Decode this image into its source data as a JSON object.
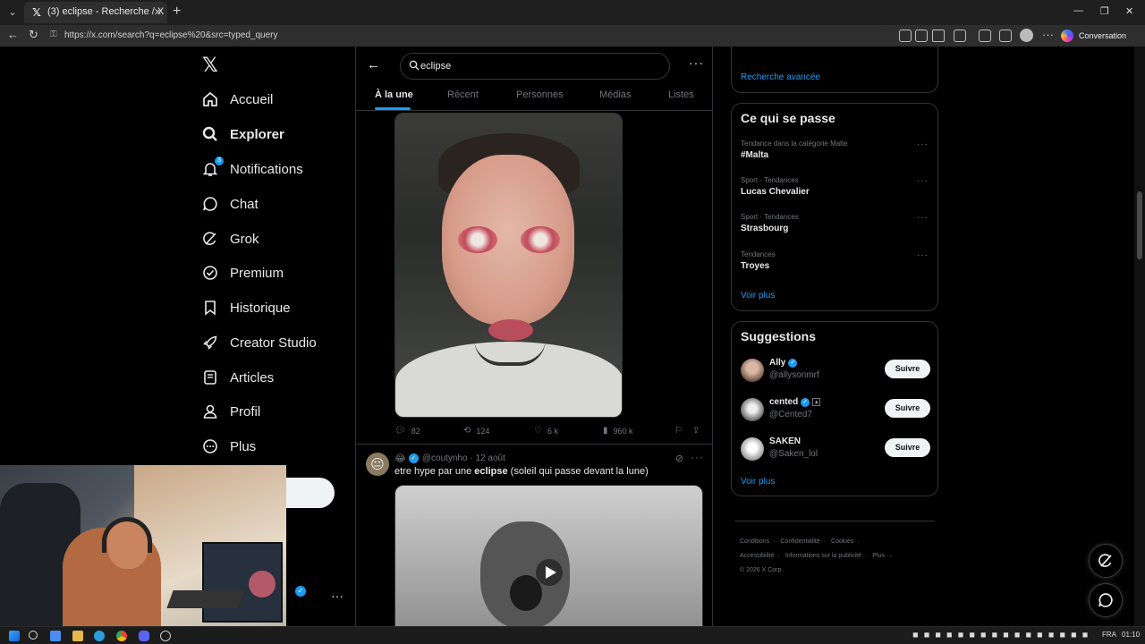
{
  "browser": {
    "tab_title": "(3) eclipse - Recherche / X",
    "url": "https://x.com/search?q=eclipse%20&src=typed_query",
    "conversation_label": "Conversation"
  },
  "nav": {
    "items": [
      {
        "label": "Accueil",
        "icon": "home-icon"
      },
      {
        "label": "Explorer",
        "icon": "search-icon",
        "active": true
      },
      {
        "label": "Notifications",
        "icon": "bell-icon",
        "badge": "3"
      },
      {
        "label": "Chat",
        "icon": "chat-icon"
      },
      {
        "label": "Grok",
        "icon": "grok-icon"
      },
      {
        "label": "Premium",
        "icon": "premium-icon"
      },
      {
        "label": "Historique",
        "icon": "bookmark-icon"
      },
      {
        "label": "Creator Studio",
        "icon": "rocket-icon"
      },
      {
        "label": "Articles",
        "icon": "articles-icon"
      },
      {
        "label": "Profil",
        "icon": "profile-icon"
      },
      {
        "label": "Plus",
        "icon": "more-circle-icon"
      }
    ]
  },
  "search": {
    "query": "eclipse",
    "tabs": [
      "À la une",
      "Récent",
      "Personnes",
      "Médias",
      "Listes"
    ],
    "active_tab": "À la une"
  },
  "tweet1": {
    "stats": {
      "replies": "82",
      "reposts": "124",
      "likes": "6 k",
      "views": "960 k"
    }
  },
  "tweet2": {
    "emoji": "😂",
    "handle": "@coutynho",
    "date": "12 août",
    "text_before": "etre hype par une ",
    "text_bold": "eclipse",
    "text_after": " (soleil qui passe devant la lune)"
  },
  "right": {
    "advanced_search": "Recherche avancée",
    "trends_title": "Ce qui se passe",
    "trends": [
      {
        "context": "Tendance dans la catégorie Malte",
        "name": "#Malta"
      },
      {
        "context": "Sport · Tendances",
        "name": "Lucas Chevalier"
      },
      {
        "context": "Sport · Tendances",
        "name": "Strasbourg"
      },
      {
        "context": "Tendances",
        "name": "Troyes"
      }
    ],
    "trends_more": "Voir plus",
    "suggestions_title": "Suggestions",
    "suggestions": [
      {
        "name": "Ally",
        "handle": "@allysonmrf",
        "button": "Suivre"
      },
      {
        "name": "cented",
        "handle": "@Cented7",
        "button": "Suivre"
      },
      {
        "name": "SAKEN",
        "handle": "@Saken_lol",
        "button": "Suivre"
      }
    ],
    "suggestions_more": "Voir plus",
    "footer": [
      "Conditions",
      "Confidentialité",
      "Cookies",
      "Accessibilité",
      "Informations sur la publicité",
      "Plus ···",
      "© 2026 X Corp."
    ]
  },
  "taskbar": {
    "lang": "FRA",
    "time": "01:10"
  },
  "colors": {
    "accent": "#1d9bf0",
    "background": "#000000",
    "border": "#2f3336",
    "muted": "#71767b"
  }
}
